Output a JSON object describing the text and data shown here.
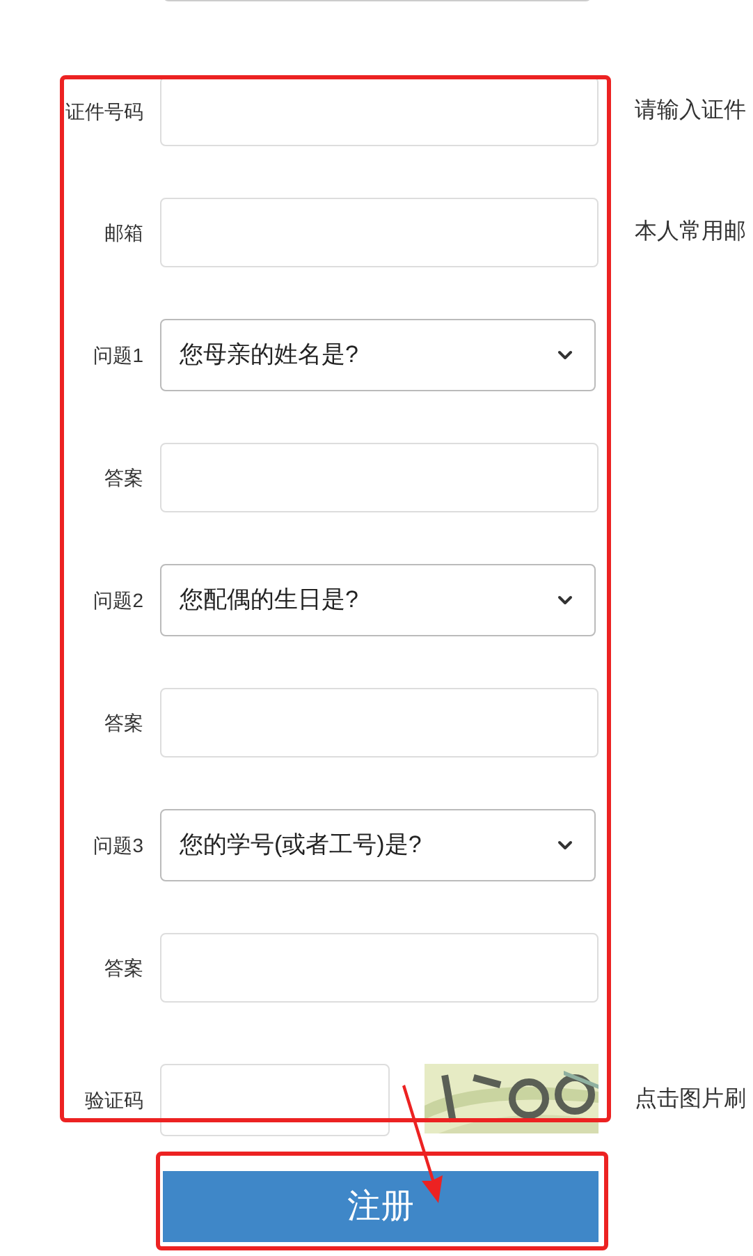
{
  "fields": [
    {
      "kind": "input",
      "label": "证件号码",
      "hint": "请输入证件"
    },
    {
      "kind": "input",
      "label": "邮箱",
      "hint": "本人常用邮"
    },
    {
      "kind": "select",
      "label": "问题1",
      "value": "您母亲的姓名是?"
    },
    {
      "kind": "input",
      "label": "答案"
    },
    {
      "kind": "select",
      "label": "问题2",
      "value": "您配偶的生日是?"
    },
    {
      "kind": "input",
      "label": "答案"
    },
    {
      "kind": "select",
      "label": "问题3",
      "value": "您的学号(或者工号)是?"
    },
    {
      "kind": "input",
      "label": "答案"
    },
    {
      "kind": "captcha",
      "label": "验证码",
      "hint": "点击图片刷"
    }
  ],
  "submit": {
    "label": "注册"
  }
}
